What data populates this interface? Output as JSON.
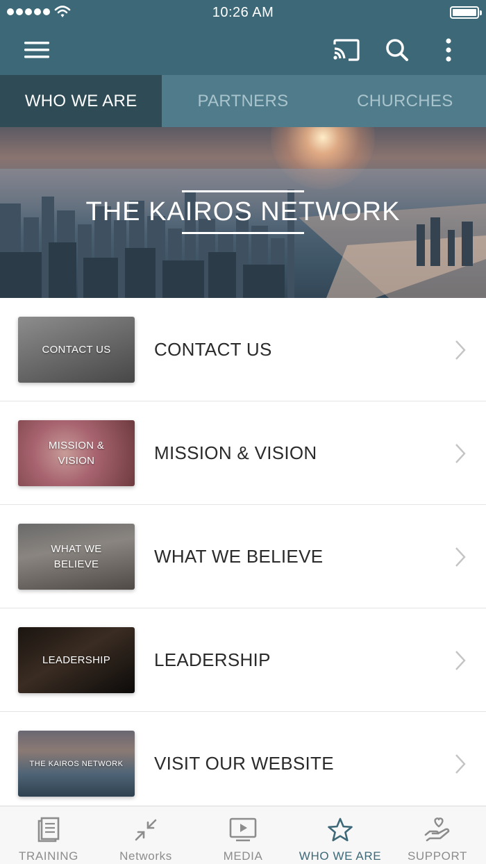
{
  "status_bar": {
    "time": "10:26 AM"
  },
  "toolbar": {
    "menu_icon": "hamburger-menu-icon",
    "cast_icon": "cast-icon",
    "search_icon": "search-icon",
    "more_icon": "more-vertical-icon"
  },
  "tabs": [
    {
      "label": "WHO WE ARE",
      "active": true
    },
    {
      "label": "PARTNERS",
      "active": false
    },
    {
      "label": "CHURCHES",
      "active": false
    }
  ],
  "banner": {
    "title": "THE KAIROS NETWORK"
  },
  "list": [
    {
      "label": "CONTACT US",
      "thumb_text": "CONTACT US"
    },
    {
      "label": "MISSION & VISION",
      "thumb_text_line1": "MISSION &",
      "thumb_text_line2": "VISION"
    },
    {
      "label": "WHAT WE BELIEVE",
      "thumb_text_line1": "WHAT WE",
      "thumb_text_line2": "BELIEVE"
    },
    {
      "label": "LEADERSHIP",
      "thumb_text": "LEADERSHIP"
    },
    {
      "label": "VISIT OUR WEBSITE",
      "thumb_text": "THE KAIROS NETWORK"
    }
  ],
  "bottom_nav": [
    {
      "label": "TRAINING",
      "icon": "book-icon"
    },
    {
      "label": "Networks",
      "icon": "arrows-in-icon"
    },
    {
      "label": "MEDIA",
      "icon": "play-screen-icon"
    },
    {
      "label": "WHO WE ARE",
      "icon": "star-icon",
      "active": true
    },
    {
      "label": "SUPPORT",
      "icon": "heart-hand-icon"
    }
  ],
  "colors": {
    "header": "#3d6877",
    "tab_bar": "#4f7b8a",
    "tab_active": "#2f4c56",
    "nav_active": "#3d6877",
    "nav_inactive": "#8c8c8c"
  }
}
